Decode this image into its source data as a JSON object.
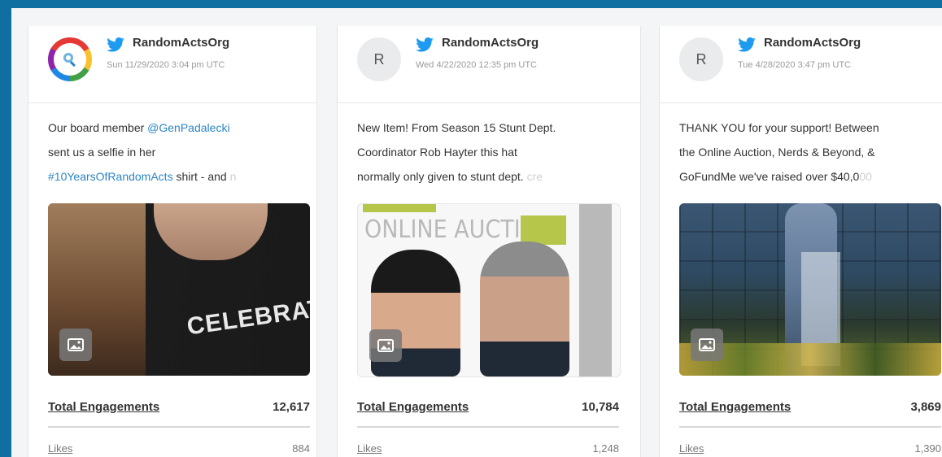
{
  "posts": [
    {
      "handle": "RandomActsOrg",
      "time": "Sun 11/29/2020 3:04 pm UTC",
      "avatar_letter": "",
      "avatar_type": "logo",
      "lines": [
        {
          "parts": [
            {
              "t": "Our board member ",
              "c": "text"
            },
            {
              "t": "@GenPadalecki",
              "c": "link"
            }
          ]
        },
        {
          "parts": [
            {
              "t": "sent us a selfie in her",
              "c": "text"
            }
          ]
        },
        {
          "parts": [
            {
              "t": "#10YearsOfRandomActs",
              "c": "link"
            },
            {
              "t": " shirt - and ",
              "c": "text"
            },
            {
              "t": "n",
              "c": "fade"
            }
          ]
        }
      ],
      "media_label": "CELEBRATING",
      "total_label": "Total Engagements",
      "total_value": "12,617",
      "likes_label": "Likes",
      "likes_value": "884"
    },
    {
      "handle": "RandomActsOrg",
      "time": "Wed 4/22/2020 12:35 pm UTC",
      "avatar_letter": "R",
      "avatar_type": "letter",
      "lines": [
        {
          "parts": [
            {
              "t": "New Item! From Season 15 Stunt Dept.",
              "c": "text"
            }
          ]
        },
        {
          "parts": [
            {
              "t": "Coordinator Rob Hayter this hat",
              "c": "text"
            }
          ]
        },
        {
          "parts": [
            {
              "t": "normally only given to stunt dept. ",
              "c": "text"
            },
            {
              "t": "cre",
              "c": "fade"
            }
          ]
        }
      ],
      "media_label": "ONLINE AUCTION",
      "total_label": "Total Engagements",
      "total_value": "10,784",
      "likes_label": "Likes",
      "likes_value": "1,248"
    },
    {
      "handle": "RandomActsOrg",
      "time": "Tue 4/28/2020 3:47 pm UTC",
      "avatar_letter": "R",
      "avatar_type": "letter",
      "lines": [
        {
          "parts": [
            {
              "t": "THANK YOU for your support! Between",
              "c": "text"
            }
          ]
        },
        {
          "parts": [
            {
              "t": "the Online Auction, Nerds & Beyond, &",
              "c": "text"
            }
          ]
        },
        {
          "parts": [
            {
              "t": "GoFundMe we've raised over $40,0",
              "c": "text"
            },
            {
              "t": "00",
              "c": "fade"
            }
          ]
        }
      ],
      "media_label": "",
      "total_label": "Total Engagements",
      "total_value": "3,869",
      "likes_label": "Likes",
      "likes_value": "1,390"
    }
  ],
  "colors": {
    "frame": "#0f6fa0",
    "link": "#2b86c6",
    "twitter": "#1d9bf0"
  },
  "icons": {
    "network": "twitter-bird-icon",
    "media": "image-icon"
  }
}
